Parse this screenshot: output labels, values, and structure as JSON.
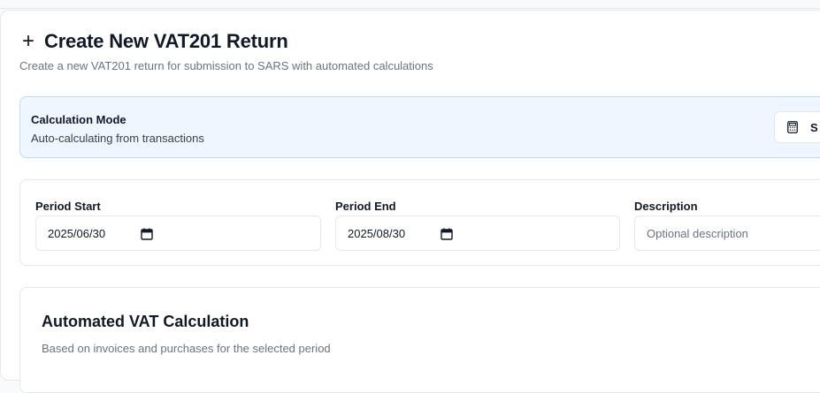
{
  "header": {
    "title": "Create New VAT201 Return",
    "subtitle": "Create a new VAT201 return for submission to SARS with automated calculations",
    "icon": "plus-icon"
  },
  "calculation_mode": {
    "title": "Calculation Mode",
    "description": "Auto-calculating from transactions",
    "button_label": "S",
    "button_icon": "calculator-icon"
  },
  "period": {
    "start_label": "Period Start",
    "start_value": "2025/06/30",
    "end_label": "Period End",
    "end_value": "2025/08/30",
    "description_label": "Description",
    "description_placeholder": "Optional description"
  },
  "automated": {
    "title": "Automated VAT Calculation",
    "description": "Based on invoices and purchases for the selected period"
  }
}
